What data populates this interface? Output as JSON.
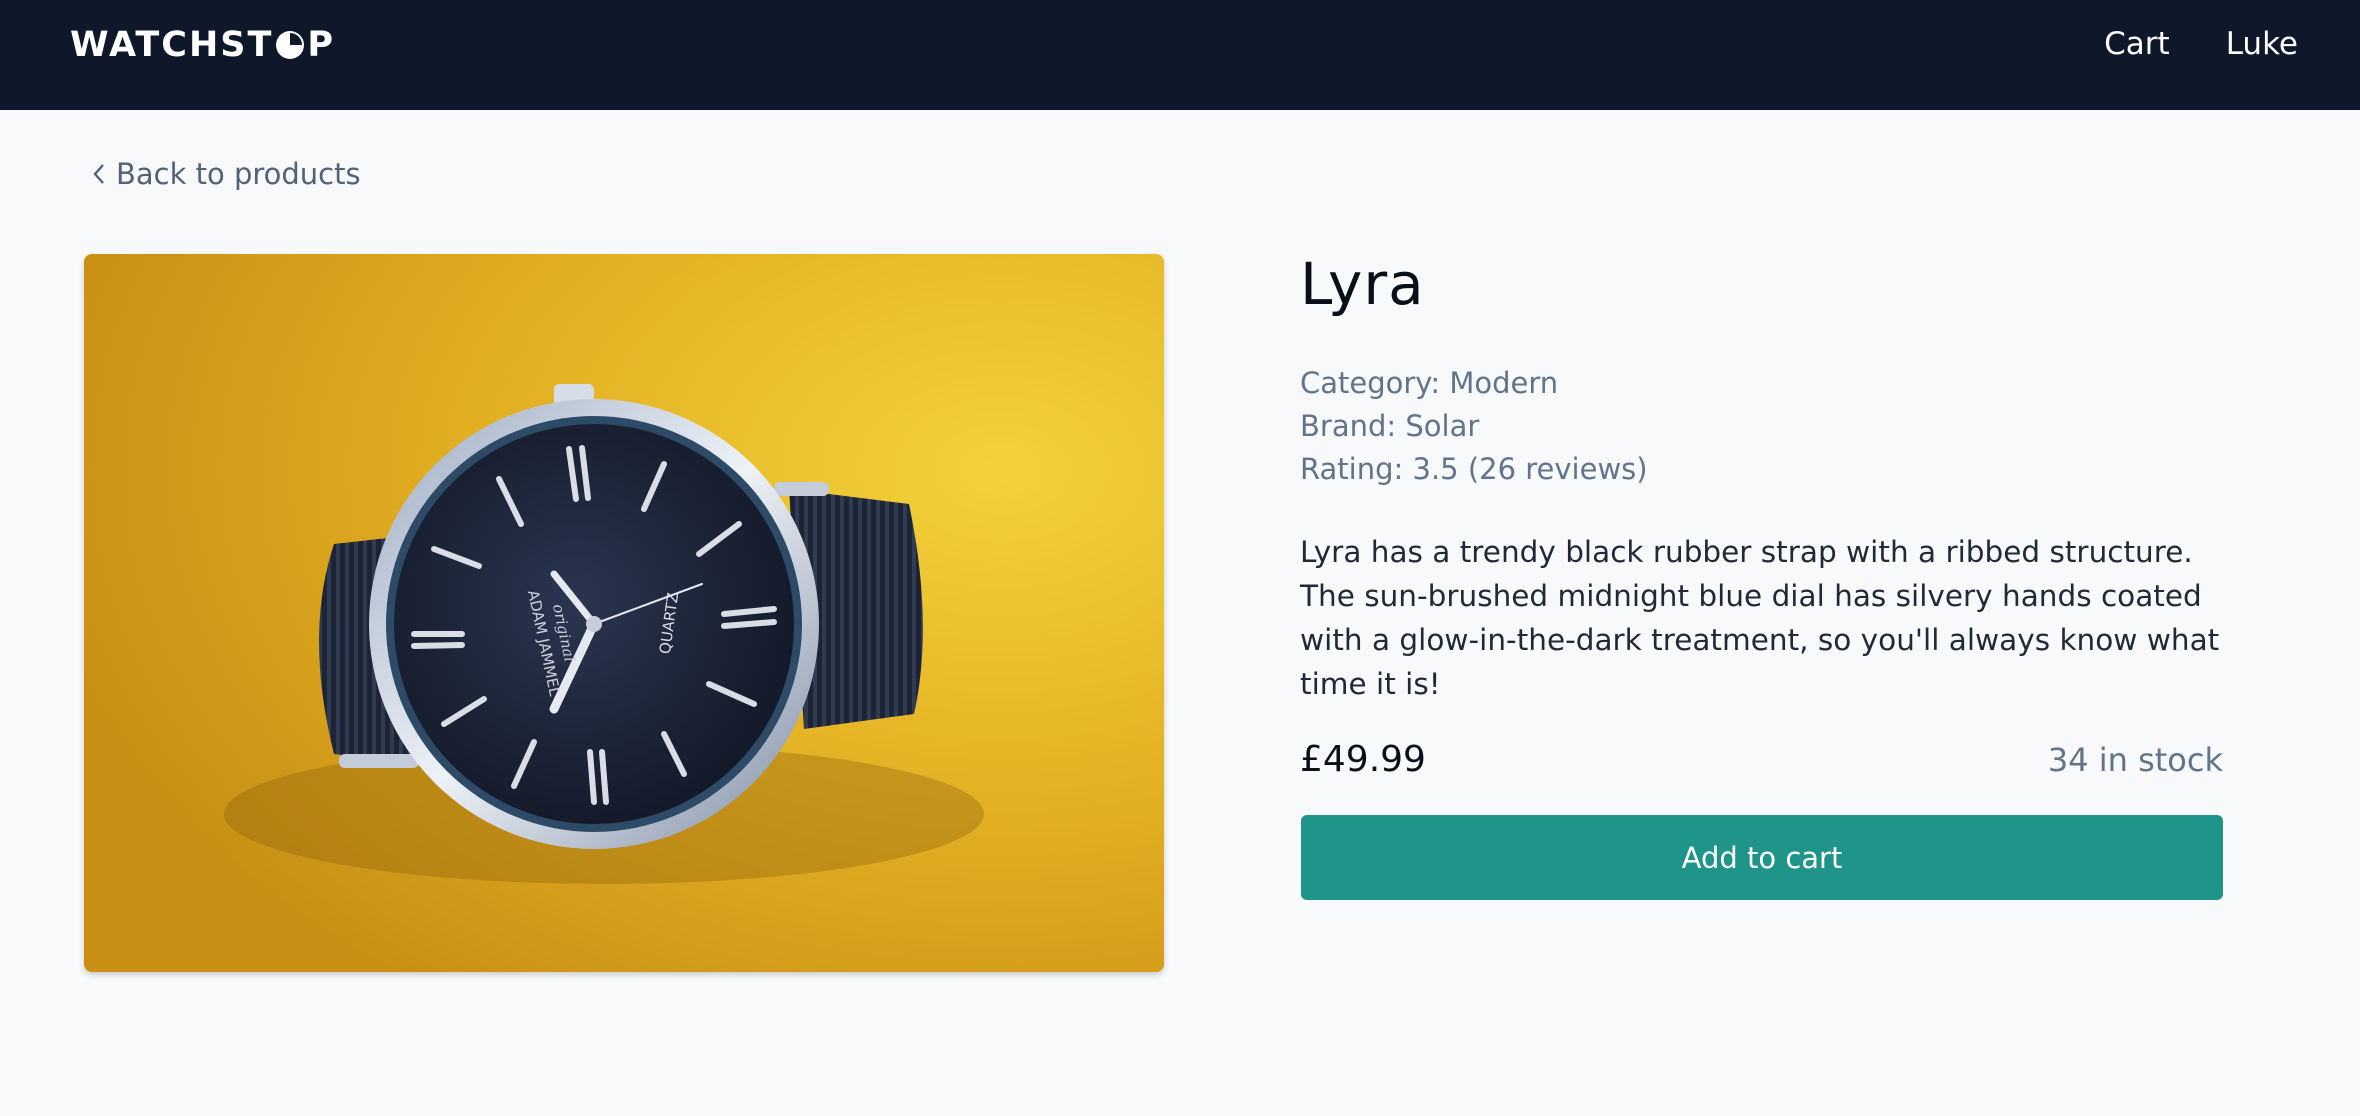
{
  "navbar": {
    "logo_left": "WATCHST",
    "logo_right": "P",
    "links": [
      "Cart",
      "Luke"
    ]
  },
  "back_link": "Back to products",
  "product": {
    "name": "Lyra",
    "category": "Category: Modern",
    "brand": "Brand: Solar",
    "rating": "Rating: 3.5 (26 reviews)",
    "description": "Lyra has a trendy black rubber strap with a ribbed structure. The sun-brushed midnight blue dial has silvery hands coated with a glow-in-the-dark treatment, so you'll always know what time it is!",
    "price": "£49.99",
    "stock": "34 in stock",
    "add_to_cart_label": "Add to cart",
    "dial_brand_text": "ADAM JAMMEL",
    "dial_sub_text": "original",
    "dial_quartz_text": "QUARTZ"
  },
  "colors": {
    "navbar": "#0f172a",
    "accent": "#1f958a",
    "page_background": "#f7f9fb",
    "image_background": "#e6b325"
  },
  "icons": {
    "logo_o": "clock-icon",
    "back": "chevron-left-icon"
  }
}
